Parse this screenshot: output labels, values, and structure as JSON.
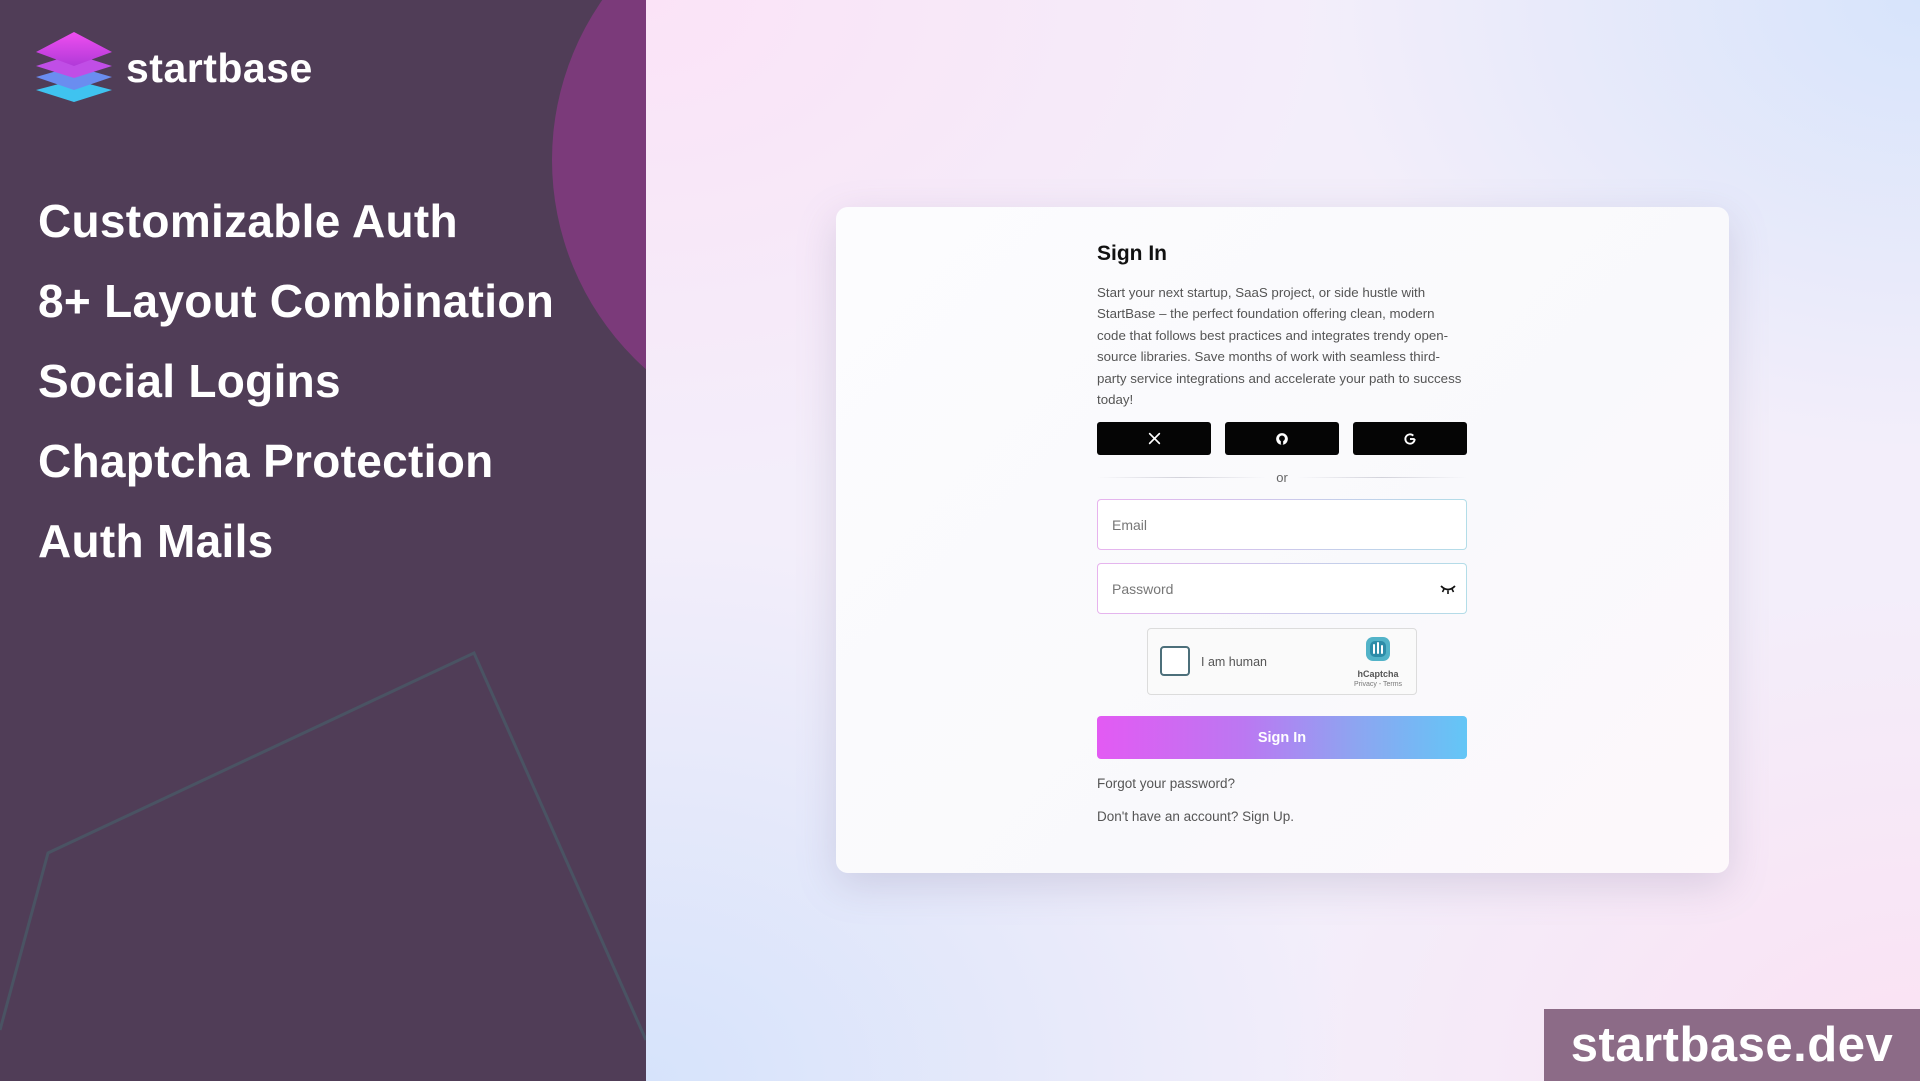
{
  "brand": {
    "name": "startbase"
  },
  "features": [
    "Customizable Auth",
    "8+ Layout Combination",
    "Social Logins",
    "Chaptcha Protection",
    "Auth Mails"
  ],
  "signin": {
    "title": "Sign In",
    "description": "Start your next startup, SaaS project, or side hustle with StartBase – the perfect foundation offering clean, modern code that follows best practices and integrates trendy open-source libraries. Save months of work with seamless third-party service integrations and accelerate your path to success today!",
    "social": [
      {
        "name": "x",
        "glyph": "𝕏"
      },
      {
        "name": "github",
        "glyph": ""
      },
      {
        "name": "google",
        "glyph": "G"
      }
    ],
    "divider": "or",
    "email_placeholder": "Email",
    "password_placeholder": "Password",
    "captcha": {
      "label": "I am human",
      "brand": "hCaptcha",
      "links": "Privacy - Terms"
    },
    "submit_label": "Sign In",
    "forgot_label": "Forgot your password?",
    "signup_label": "Don't have an account? Sign Up."
  },
  "watermark": "startbase.dev",
  "colors": {
    "left_panel": "#503d57",
    "accent_gradient_start": "#e35af3",
    "accent_gradient_end": "#63c6f6"
  }
}
